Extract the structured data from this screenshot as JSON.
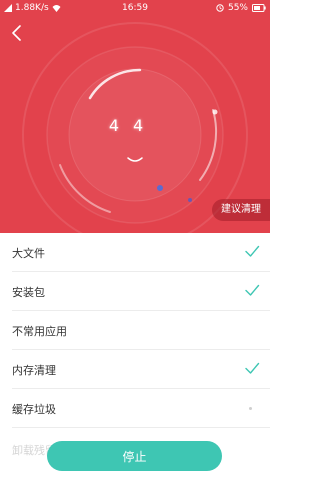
{
  "status_bar": {
    "signal": "1.88K/s",
    "time": "16:59",
    "battery": "55%"
  },
  "header": {
    "back_icon": "chevron-left-icon"
  },
  "scan": {
    "readout_left": "4",
    "readout_right": "4",
    "suggest_button": "建议清理"
  },
  "list": {
    "items": [
      {
        "label": "大文件",
        "status": "checked"
      },
      {
        "label": "安装包",
        "status": "checked"
      },
      {
        "label": "不常用应用",
        "status": "none"
      },
      {
        "label": "内存清理",
        "status": "checked"
      },
      {
        "label": "缓存垃圾",
        "status": "scanning"
      }
    ],
    "faded_label": "卸载残留"
  },
  "footer": {
    "stop_button": "停止"
  },
  "colors": {
    "hero_bg": "#e2424c",
    "accent": "#3ec6b3"
  }
}
